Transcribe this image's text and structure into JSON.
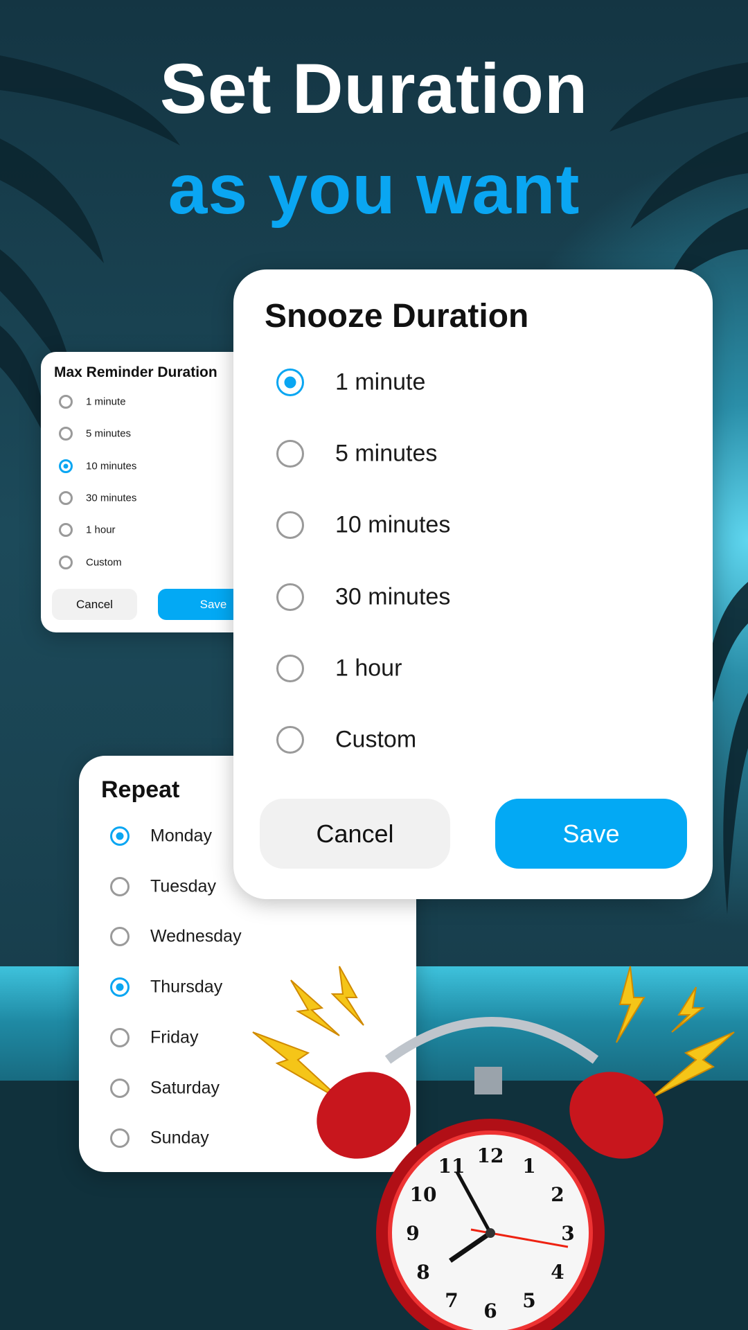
{
  "headline": {
    "line1": "Set Duration",
    "line2": "as you want"
  },
  "colors": {
    "accent": "#03a9f4",
    "background": "#143543"
  },
  "max_reminder": {
    "title": "Max Reminder Duration",
    "options": [
      "1 minute",
      "5 minutes",
      "10 minutes",
      "30 minutes",
      "1 hour",
      "Custom"
    ],
    "selected_index": 2,
    "cancel_label": "Cancel",
    "save_label": "Save"
  },
  "snooze": {
    "title": "Snooze Duration",
    "options": [
      "1 minute",
      "5 minutes",
      "10 minutes",
      "30 minutes",
      "1 hour",
      "Custom"
    ],
    "selected_index": 0,
    "cancel_label": "Cancel",
    "save_label": "Save"
  },
  "repeat": {
    "title": "Repeat",
    "days": [
      "Monday",
      "Tuesday",
      "Wednesday",
      "Thursday",
      "Friday",
      "Saturday",
      "Sunday"
    ],
    "selected": [
      0,
      3
    ]
  },
  "clock": {
    "icon": "alarm-clock-icon",
    "numerals": [
      "12",
      "1",
      "2",
      "3",
      "4",
      "5",
      "6",
      "7",
      "8",
      "9",
      "10",
      "11"
    ]
  }
}
